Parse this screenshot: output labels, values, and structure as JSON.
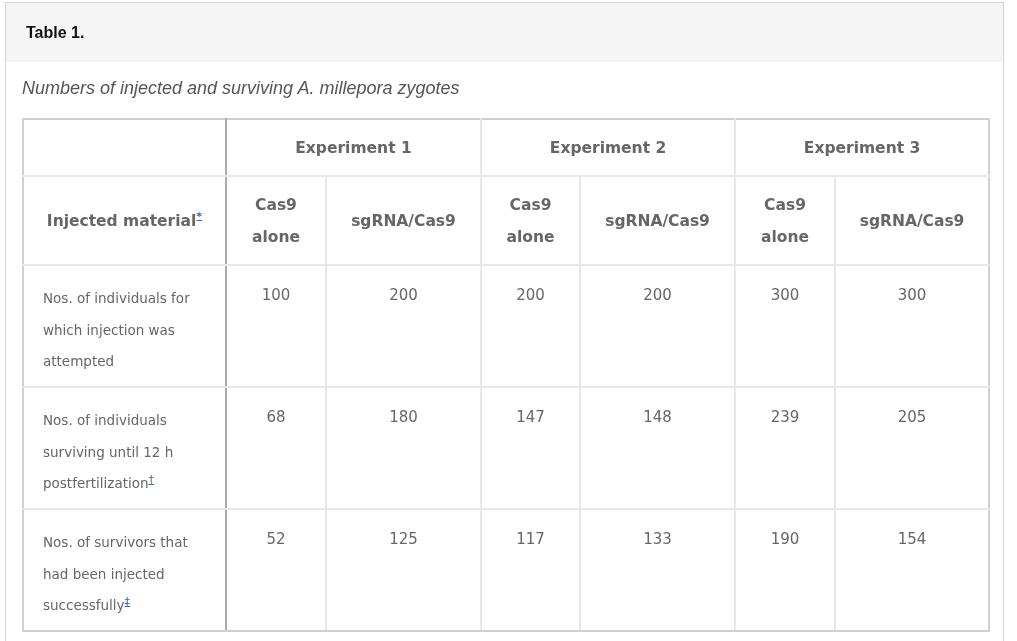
{
  "title": "Table 1.",
  "caption": "Numbers of injected and surviving A. millepora zygotes",
  "table": {
    "corner_label": "Injected material",
    "corner_note": "*",
    "groups": [
      "Experiment 1",
      "Experiment 2",
      "Experiment 3"
    ],
    "columns": [
      "Cas9 alone",
      "sgRNA/Cas9",
      "Cas9 alone",
      "sgRNA/Cas9",
      "Cas9 alone",
      "sgRNA/Cas9"
    ],
    "rows": [
      {
        "label": "Nos. of individuals for which injection was attempted",
        "cells": [
          "100",
          "200",
          "200",
          "200",
          "300",
          "300"
        ]
      },
      {
        "label": "Nos. of individuals surviving until 12 h postfertilization",
        "note": "†",
        "cells": [
          "68",
          "180",
          "147",
          "148",
          "239",
          "205"
        ]
      },
      {
        "label": "Nos. of survivors that had been injected successfully",
        "note": "‡",
        "cells": [
          "52",
          "125",
          "117",
          "133",
          "190",
          "154"
        ]
      }
    ]
  }
}
